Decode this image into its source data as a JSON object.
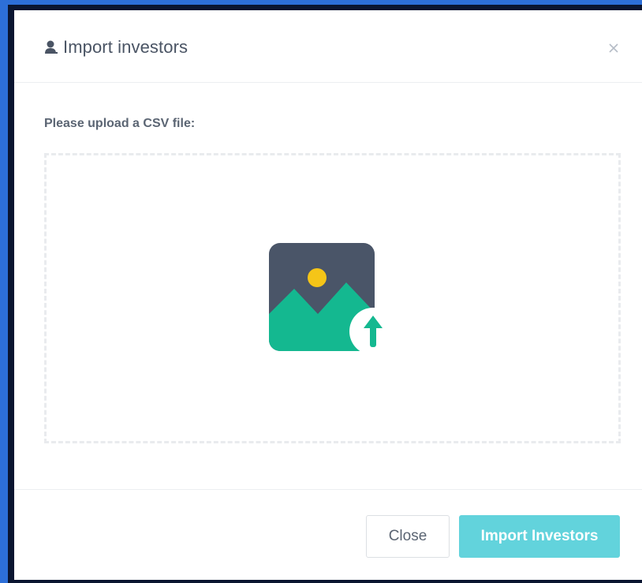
{
  "modal": {
    "title": "Import investors",
    "title_icon": "user-icon",
    "close_icon": "close-icon"
  },
  "body": {
    "label": "Please upload a CSV file:",
    "dropzone_icon": "image-upload-icon"
  },
  "footer": {
    "close_label": "Close",
    "import_label": "Import Investors"
  },
  "colors": {
    "primary_button": "#62d3dc",
    "icon_dark": "#4a5568",
    "icon_green": "#14b890",
    "icon_sun": "#f5c518"
  }
}
